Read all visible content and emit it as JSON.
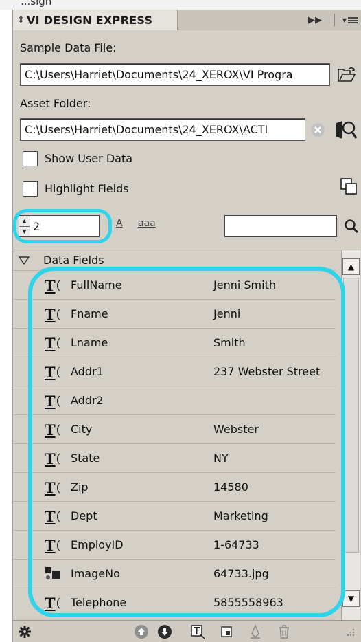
{
  "app": {
    "title_fragment": "...sign",
    "panel_title": "VI DESIGN EXPRESS"
  },
  "sample_data": {
    "label": "Sample Data File:",
    "path": "C:\\Users\\Harriet\\Documents\\24_XEROX\\VI Progra"
  },
  "asset_folder": {
    "label": "Asset Folder:",
    "path": "C:\\Users\\Harriet\\Documents\\24_XEROX\\ACTI"
  },
  "options": {
    "show_user_data": "Show User Data",
    "highlight_fields": "Highlight Fields"
  },
  "record_nav": {
    "record_number": "2",
    "case_upper": "A",
    "case_lower": "aaa"
  },
  "find": {
    "value": ""
  },
  "data_fields": {
    "header": "Data Fields",
    "rows": [
      {
        "name": "FullName",
        "value": "Jenni Smith",
        "icon": "text-field-icon"
      },
      {
        "name": "Fname",
        "value": "Jenni",
        "icon": "text-field-icon"
      },
      {
        "name": "Lname",
        "value": "Smith",
        "icon": "text-field-icon"
      },
      {
        "name": "Addr1",
        "value": "237 Webster Street",
        "icon": "text-field-icon"
      },
      {
        "name": "Addr2",
        "value": "",
        "icon": "text-field-icon"
      },
      {
        "name": "City",
        "value": "Webster",
        "icon": "text-field-icon"
      },
      {
        "name": "State",
        "value": "NY",
        "icon": "text-field-icon"
      },
      {
        "name": "Zip",
        "value": "14580",
        "icon": "text-field-icon"
      },
      {
        "name": "Dept",
        "value": "Marketing",
        "icon": "text-field-icon"
      },
      {
        "name": "EmployID",
        "value": "1-64733",
        "icon": "text-field-icon"
      },
      {
        "name": "ImageNo",
        "value": "64733.jpg",
        "icon": "image-field-icon"
      },
      {
        "name": "Telephone",
        "value": "5855558963",
        "icon": "text-field-icon"
      }
    ]
  },
  "colors": {
    "panel_bg": "#d4d0c8",
    "highlight_ring": "#2fd3ea"
  }
}
